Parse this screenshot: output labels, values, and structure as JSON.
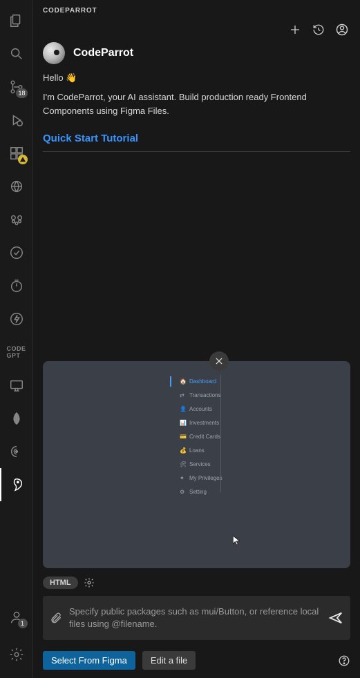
{
  "title": "CODEPARROT",
  "bot": {
    "name": "CodeParrot",
    "greeting": "Hello 👋",
    "description": "I'm CodeParrot, your AI assistant. Build production ready Frontend Components using Figma Files."
  },
  "quick_start_label": "Quick Start Tutorial",
  "activity_bar": {
    "items": [
      {
        "name": "explorer-icon",
        "badge": null
      },
      {
        "name": "search-icon",
        "badge": null
      },
      {
        "name": "source-control-icon",
        "badge": "18"
      },
      {
        "name": "run-debug-icon",
        "badge": null
      },
      {
        "name": "extensions-icon",
        "badge": "warn"
      },
      {
        "name": "remote-explorer-icon",
        "badge": null
      },
      {
        "name": "copilot-icon",
        "badge": null
      },
      {
        "name": "testing-check-icon",
        "badge": null
      },
      {
        "name": "timer-icon",
        "badge": null
      },
      {
        "name": "bolt-icon",
        "badge": null
      },
      {
        "name": "codept-icon",
        "text": "CODE\nGPT"
      },
      {
        "name": "remote-window-icon",
        "badge": null
      },
      {
        "name": "mongodb-leaf-icon",
        "badge": null
      },
      {
        "name": "signal-icon",
        "badge": null
      },
      {
        "name": "parrot-icon",
        "badge": null,
        "active": true
      }
    ],
    "bottom": [
      {
        "name": "accounts-icon",
        "badge": "1"
      },
      {
        "name": "settings-icon",
        "badge": null
      }
    ]
  },
  "preview": {
    "nav": [
      {
        "label": "Dashboard",
        "icon": "home",
        "active": true
      },
      {
        "label": "Transactions",
        "icon": "transfer"
      },
      {
        "label": "Accounts",
        "icon": "user"
      },
      {
        "label": "Investments",
        "icon": "chart"
      },
      {
        "label": "Credit Cards",
        "icon": "card"
      },
      {
        "label": "Loans",
        "icon": "loan"
      },
      {
        "label": "Services",
        "icon": "tools"
      },
      {
        "label": "My Privileges",
        "icon": "privilege"
      },
      {
        "label": "Setting",
        "icon": "gear"
      }
    ]
  },
  "chip": {
    "language": "HTML"
  },
  "input": {
    "placeholder": "Specify public packages such as mui/Button, or reference local files using @filename."
  },
  "buttons": {
    "select_figma": "Select From Figma",
    "edit_file": "Edit a file"
  }
}
